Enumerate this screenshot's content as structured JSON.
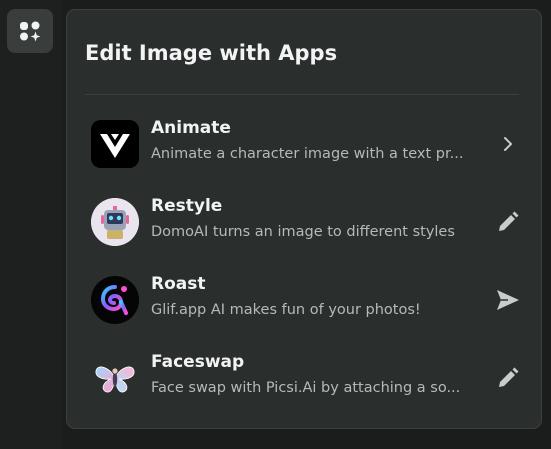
{
  "sidebar": {
    "apps_button_icon": "apps-grid-icon"
  },
  "popup": {
    "title": "Edit Image with Apps",
    "apps": [
      {
        "name": "Animate",
        "description": "Animate a character image with a text pr...",
        "logo_icon": "viggle-v-logo",
        "action_icon": "chevron-right-icon"
      },
      {
        "name": "Restyle",
        "description": "DomoAI turns an image to different styles",
        "logo_icon": "domoai-robot-logo",
        "action_icon": "pencil-icon"
      },
      {
        "name": "Roast",
        "description": "Glif.app AI makes fun of your photos!",
        "logo_icon": "glif-logo",
        "action_icon": "send-icon"
      },
      {
        "name": "Faceswap",
        "description": "Face swap with Picsi.Ai by attaching a so...",
        "logo_icon": "picsi-butterfly-logo",
        "action_icon": "pencil-icon"
      }
    ]
  },
  "colors": {
    "background": "#1b1d1c",
    "popup_bg": "#2a2e2d",
    "title_text": "#f2f3f5",
    "desc_text": "#b5bab8",
    "icon_color": "#c8cccb"
  }
}
